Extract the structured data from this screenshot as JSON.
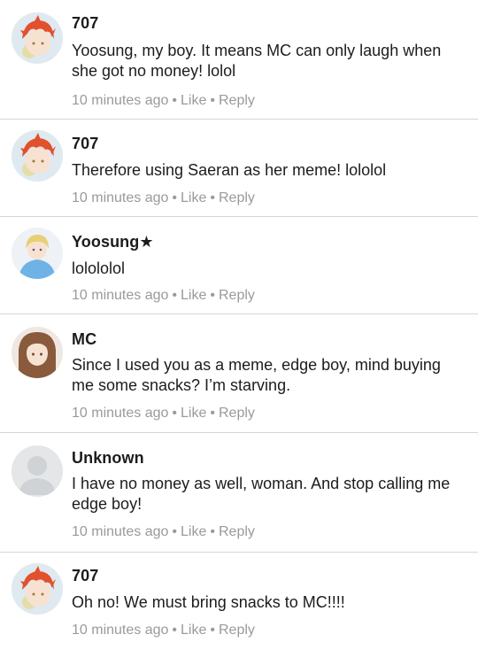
{
  "comments": [
    {
      "avatar_icon": "707-avatar",
      "name": "707",
      "text": "Yoosung, my boy. It means MC can only laugh when she got no money! lolol",
      "time": "10 minutes ago",
      "like": "Like",
      "reply": "Reply"
    },
    {
      "avatar_icon": "707-avatar",
      "name": "707",
      "text": "Therefore using Saeran as her meme! lololol",
      "time": "10 minutes ago",
      "like": "Like",
      "reply": "Reply"
    },
    {
      "avatar_icon": "yoosung-avatar",
      "name": "Yoosung★",
      "text": "lolololol",
      "time": "10 minutes ago",
      "like": "Like",
      "reply": "Reply"
    },
    {
      "avatar_icon": "mc-avatar",
      "name": "MC",
      "text": "Since I used you as a meme, edge boy, mind buying me some snacks? I’m starving.",
      "time": "10 minutes ago",
      "like": "Like",
      "reply": "Reply"
    },
    {
      "avatar_icon": "default-user-avatar",
      "name": "Unknown",
      "text": "I have no money as well, woman. And stop calling me edge boy!",
      "time": "10 minutes ago",
      "like": "Like",
      "reply": "Reply"
    },
    {
      "avatar_icon": "707-avatar",
      "name": "707",
      "text": "Oh no! We must bring snacks to MC!!!!",
      "time": "10 minutes ago",
      "like": "Like",
      "reply": "Reply"
    }
  ],
  "separator": "•",
  "colors": {
    "text": "#1c1c1c",
    "meta": "#9a9a9a",
    "divider": "#d6d6d6",
    "hair_707": "#e2502c",
    "hair_yoosung": "#e8cf74",
    "hoodie_yoosung": "#6fb3e6",
    "hair_mc": "#8a5a3c",
    "default_avatar": "#cfd3d6"
  }
}
